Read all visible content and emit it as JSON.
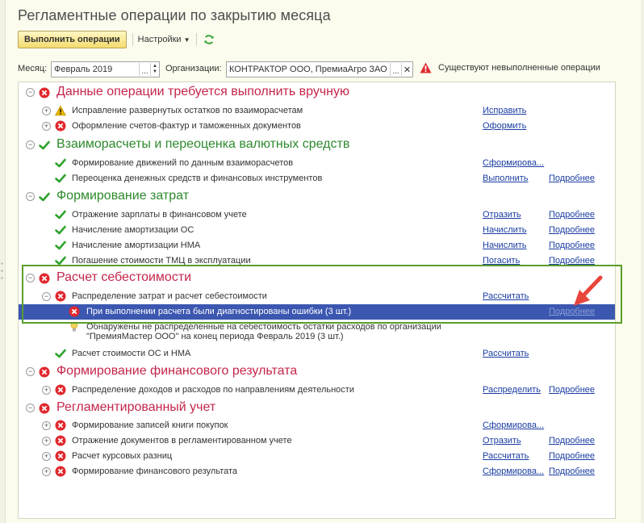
{
  "window": {
    "title": "Регламентные операции по закрытию месяца"
  },
  "toolbar": {
    "run_label": "Выполнить операции",
    "settings_label": "Настройки"
  },
  "filters": {
    "month_label": "Месяц:",
    "month_value": "Февраль 2019",
    "org_label": "Организации:",
    "org_value": "КОНТРАКТОР ООО, ПремиаАгро ЗАО",
    "warning_text": "Существуют невыполненные операции"
  },
  "groups": [
    {
      "title": "Данные операции требуется выполнить вручную",
      "status": "error",
      "items": [
        {
          "label": "Исправление развернутых остатков по взаиморасчетам",
          "status": "warning",
          "action": "Исправить",
          "more": ""
        },
        {
          "label": "Оформление счетов-фактур и таможенных документов",
          "status": "error",
          "action": "Оформить",
          "more": ""
        }
      ]
    },
    {
      "title": "Взаиморасчеты и переоценка валютных средств",
      "status": "ok",
      "items": [
        {
          "label": "Формирование движений по данным взаиморасчетов",
          "status": "ok",
          "action": "Сформирова...",
          "more": ""
        },
        {
          "label": "Переоценка денежных средств и финансовых инструментов",
          "status": "ok",
          "action": "Выполнить",
          "more": "Подробнее"
        }
      ]
    },
    {
      "title": "Формирование затрат",
      "status": "ok",
      "items": [
        {
          "label": "Отражение зарплаты в финансовом учете",
          "status": "ok",
          "action": "Отразить",
          "more": "Подробнее"
        },
        {
          "label": "Начисление амортизации ОС",
          "status": "ok",
          "action": "Начислить",
          "more": "Подробнее"
        },
        {
          "label": "Начисление амортизации НМА",
          "status": "ok",
          "action": "Начислить",
          "more": "Подробнее"
        },
        {
          "label": "Погашение стоимости ТМЦ в эксплуатации",
          "status": "ok",
          "action": "Погасить",
          "more": "Подробнее"
        }
      ]
    },
    {
      "title": "Расчет себестоимости",
      "status": "error",
      "items": [
        {
          "label": "Распределение затрат и расчет себестоимости",
          "status": "error",
          "action": "Рассчитать",
          "more": ""
        },
        {
          "label": "При выполнении расчета были диагностированы ошибки (3 шт.)",
          "status": "error",
          "action": "",
          "more": "Подробнее"
        },
        {
          "label": "Обнаружены не распределенные на себестоимость остатки расходов по организации",
          "label2": "\"ПремияМастер ООО\" на конец периода Февраль 2019 (3 шт.)",
          "status": "hint",
          "action": "",
          "more": ""
        },
        {
          "label": "Расчет стоимости ОС и НМА",
          "status": "ok",
          "action": "Рассчитать",
          "more": ""
        }
      ]
    },
    {
      "title": "Формирование финансового результата",
      "status": "error",
      "items": [
        {
          "label": "Распределение доходов и расходов по направлениям деятельности",
          "status": "error",
          "action": "Распределить",
          "more": "Подробнее"
        }
      ]
    },
    {
      "title": "Регламентированный учет",
      "status": "error",
      "items": [
        {
          "label": "Формирование записей книги покупок",
          "status": "error",
          "action": "Сформирова...",
          "more": ""
        },
        {
          "label": "Отражение документов в регламентированном учете",
          "status": "error",
          "action": "Отразить",
          "more": "Подробнее"
        },
        {
          "label": "Расчет курсовых разниц",
          "status": "error",
          "action": "Рассчитать",
          "more": "Подробнее"
        },
        {
          "label": "Формирование финансового результата",
          "status": "error",
          "action": "Сформирова...",
          "more": "Подробнее"
        }
      ]
    }
  ],
  "colors": {
    "error": "#e0282e",
    "ok": "#2ea32e",
    "warning": "#e8b400",
    "selection": "#3b57b0",
    "highlight": "#5a9e2c",
    "annotation_arrow": "#e8453c"
  }
}
